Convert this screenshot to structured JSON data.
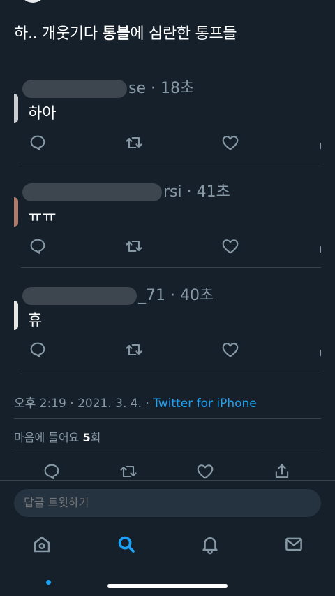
{
  "tweet": {
    "text_prefix": "하.. 개웃기다 ",
    "text_bold": "통블",
    "text_suffix": "에 심란한 통프들"
  },
  "replies": [
    {
      "handle_visible": "se",
      "time": "18초",
      "text": "하아",
      "avatar_color": "#c9ccd1"
    },
    {
      "handle_visible": "rsi",
      "time": "41초",
      "text": "ㅠㅠ",
      "avatar_color": "#b07a6a"
    },
    {
      "handle_visible": "_71",
      "time": "40초",
      "text": "휴",
      "avatar_color": "#e6e6e6"
    }
  ],
  "meta": {
    "time": "오후 2:19",
    "date": "2021. 3. 4.",
    "source": "Twitter for iPhone",
    "likes_label": "마음에 들어요",
    "likes_count": "5",
    "likes_unit": "회"
  },
  "composer": {
    "placeholder": "답글 트윗하기"
  },
  "icons": {
    "reply": "reply-icon",
    "retweet": "retweet-icon",
    "like": "like-icon",
    "share": "share-icon",
    "home": "home-icon",
    "search": "search-icon",
    "notifications": "bell-icon",
    "messages": "mail-icon"
  },
  "colors": {
    "background": "#15202b",
    "accent": "#1da1f2",
    "secondary_text": "#8899a6"
  }
}
